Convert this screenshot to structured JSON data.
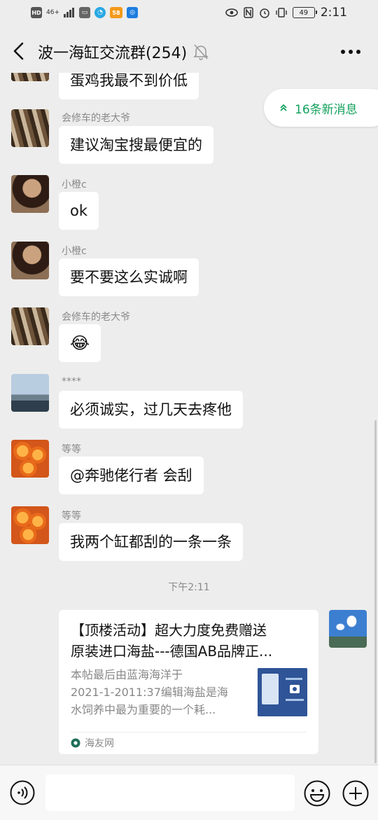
{
  "status_bar": {
    "hd": "HD",
    "net": "46+",
    "app_58": "58",
    "time": "2:11",
    "battery": "49"
  },
  "header": {
    "title": "波一海缸交流群(254)"
  },
  "new_messages": {
    "label": "16条新消息"
  },
  "messages": [
    {
      "sender": "",
      "text": "蛋鸡我最不到价低",
      "avatar": "mechanic-avatar"
    },
    {
      "sender": "会修车的老大爷",
      "text": "建议淘宝搜最便宜的",
      "avatar": "mechanic-avatar"
    },
    {
      "sender": "小橙c",
      "text": "ok",
      "avatar": "girl-avatar"
    },
    {
      "sender": "小橙c",
      "text": "要不要这么实诚啊",
      "avatar": "girl-avatar"
    },
    {
      "sender": "会修车的老大爷",
      "text": "😂",
      "avatar": "mechanic-avatar"
    },
    {
      "sender": "****",
      "text": "必须诚实，过几天去疼他",
      "avatar": "sea-avatar"
    },
    {
      "sender": "等等",
      "text": "@奔驰佬行者  会刮",
      "avatar": "oranges-avatar"
    },
    {
      "sender": "等等",
      "text": "我两个缸都刮的一条一条",
      "avatar": "oranges-avatar"
    }
  ],
  "timestamp": "下午2:11",
  "link_card": {
    "title_line1": "【顶楼活动】超大力度免费赠送",
    "title_line2": "原装进口海盐---德国AB品牌正...",
    "desc_line1": "本帖最后由蓝海海洋于",
    "desc_line2": "2021-1-2011:37编辑海盐是海",
    "desc_line3": "水饲养中最为重要的一个耗...",
    "source": "海友网"
  },
  "input": {
    "placeholder": ""
  }
}
